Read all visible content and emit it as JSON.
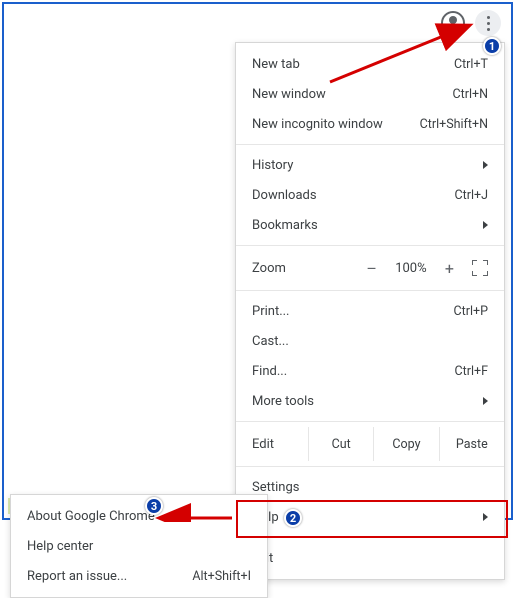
{
  "toolbar": {
    "profile_icon": "user-circle",
    "menu_icon": "three-dot-vertical"
  },
  "menu": {
    "new_tab": {
      "label": "New tab",
      "shortcut": "Ctrl+T"
    },
    "new_window": {
      "label": "New window",
      "shortcut": "Ctrl+N"
    },
    "incognito": {
      "label": "New incognito window",
      "shortcut": "Ctrl+Shift+N"
    },
    "history": {
      "label": "History"
    },
    "downloads": {
      "label": "Downloads",
      "shortcut": "Ctrl+J"
    },
    "bookmarks": {
      "label": "Bookmarks"
    },
    "zoom": {
      "label": "Zoom",
      "minus": "–",
      "value": "100%",
      "plus": "+"
    },
    "print": {
      "label": "Print...",
      "shortcut": "Ctrl+P"
    },
    "cast": {
      "label": "Cast..."
    },
    "find": {
      "label": "Find...",
      "shortcut": "Ctrl+F"
    },
    "more_tools": {
      "label": "More tools"
    },
    "edit": {
      "label": "Edit",
      "cut": "Cut",
      "copy": "Copy",
      "paste": "Paste"
    },
    "settings": {
      "label": "Settings"
    },
    "help": {
      "label": "Help"
    },
    "exit": {
      "label": "Exit"
    }
  },
  "submenu": {
    "about": {
      "label": "About Google Chrome"
    },
    "help_center": {
      "label": "Help center"
    },
    "report": {
      "label": "Report an issue...",
      "shortcut": "Alt+Shift+I"
    }
  },
  "badges": {
    "one": "1",
    "two": "2",
    "three": "3"
  }
}
